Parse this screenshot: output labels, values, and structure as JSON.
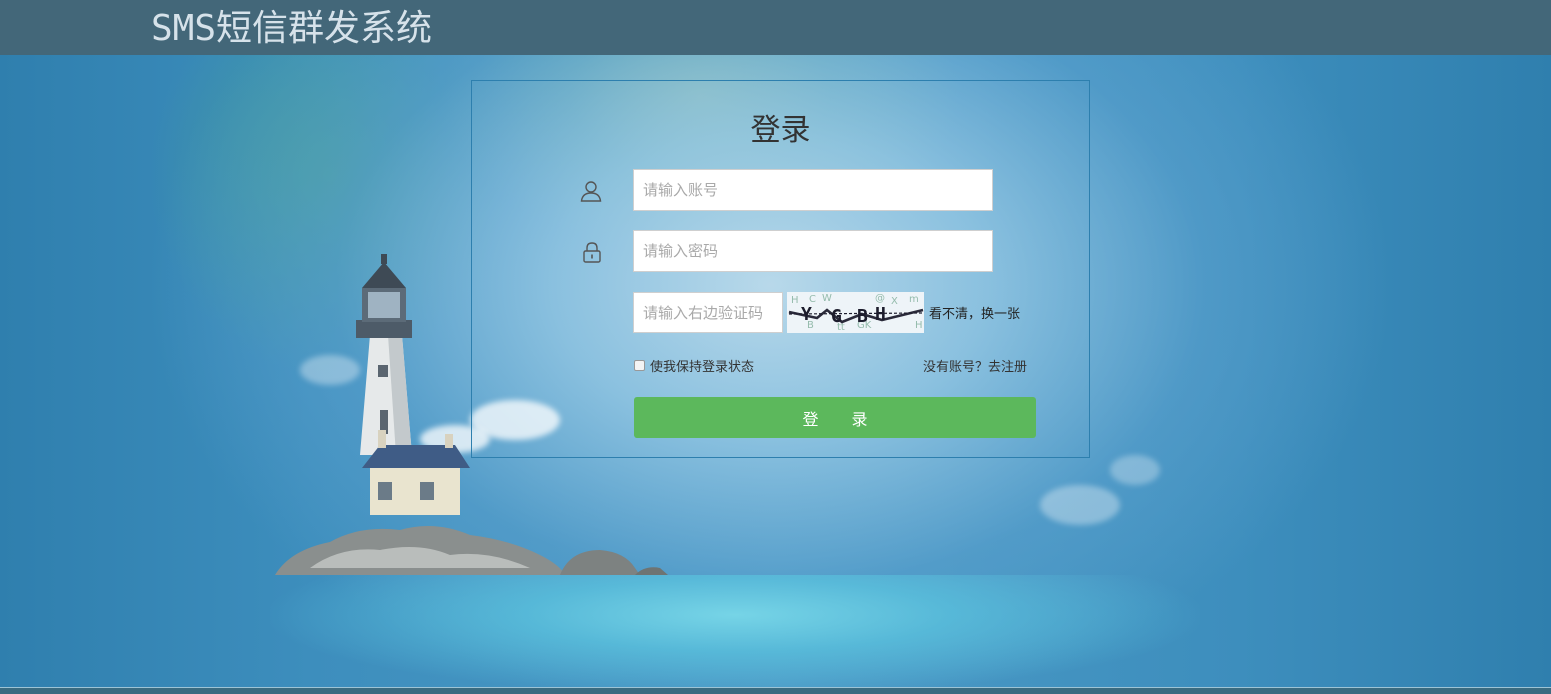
{
  "app": {
    "title": "SMS短信群发系统"
  },
  "login": {
    "heading": "登录",
    "username": {
      "value": "",
      "placeholder": "请输入账号",
      "icon": "user-icon"
    },
    "password": {
      "value": "",
      "placeholder": "请输入密码",
      "icon": "lock-icon"
    },
    "captcha": {
      "value": "",
      "placeholder": "请输入右边验证码",
      "refresh_label": "看不清，换一张"
    },
    "remember_label": "使我保持登录状态",
    "remember_checked": false,
    "register_label": "没有账号？去注册",
    "submit_label": "登 录"
  },
  "colors": {
    "header": "#436779",
    "background": "#3585b4",
    "panel_border": "#2d7fae",
    "button": "#5cb85c",
    "title_text": "#d6e2ea"
  }
}
